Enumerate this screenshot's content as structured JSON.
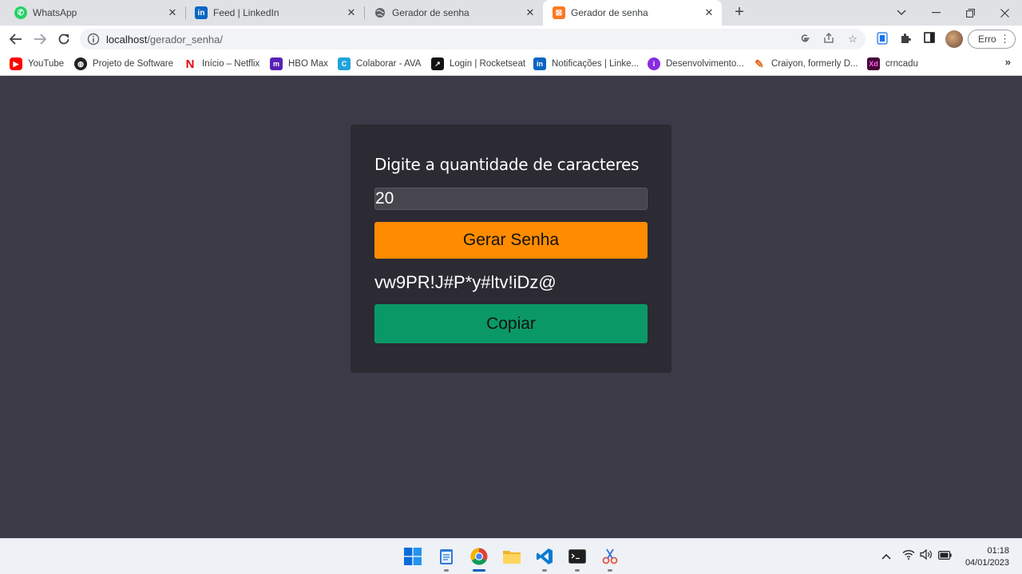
{
  "browser": {
    "tabs": [
      {
        "title": "WhatsApp",
        "icon": "whatsapp-icon",
        "color": "#25d366"
      },
      {
        "title": "Feed | LinkedIn",
        "icon": "linkedin-icon",
        "color": "#0a66c2"
      },
      {
        "title": "Gerador de senha",
        "icon": "globe-icon",
        "color": "#5f6368"
      },
      {
        "title": "Gerador de senha",
        "icon": "xampp-icon",
        "color": "#fb7a24",
        "active": true
      }
    ],
    "url_host": "localhost",
    "url_path": "/gerador_senha/",
    "profile_button": "Erro",
    "bookmarks": [
      {
        "label": "YouTube",
        "icon": "youtube-icon",
        "color": "#ff0000"
      },
      {
        "label": "Projeto de Software",
        "icon": "globe-icon",
        "color": "#202124"
      },
      {
        "label": "Início – Netflix",
        "icon": "netflix-icon",
        "color": "#e50914"
      },
      {
        "label": "HBO Max",
        "icon": "hbomax-icon",
        "color": "#5822b4"
      },
      {
        "label": "Colaborar - AVA",
        "icon": "colaborar-icon",
        "color": "#1fa3dc"
      },
      {
        "label": "Login | Rocketseat",
        "icon": "rocketseat-icon",
        "color": "#121214"
      },
      {
        "label": "Notificações | Linke...",
        "icon": "linkedin-icon",
        "color": "#0a66c2"
      },
      {
        "label": "Desenvolvimento...",
        "icon": "dev-icon",
        "color": "#8a2be2"
      },
      {
        "label": "Craiyon, formerly D...",
        "icon": "pencil-icon",
        "color": "#e46b1f"
      },
      {
        "label": "crncadu",
        "icon": "xd-icon",
        "color": "#470137"
      }
    ]
  },
  "app": {
    "heading": "Digite a quantidade de caracteres",
    "quantity_value": "20",
    "generate_label": "Gerar Senha",
    "password": "vw9PR!J#P*y#ltv!iDz@",
    "copy_label": "Copiar",
    "colors": {
      "background": "#3c3a47",
      "card": "#2c2a33",
      "generate": "#ff8c00",
      "copy": "#0a9966"
    }
  },
  "taskbar": {
    "time": "01:18",
    "date": "04/01/2023"
  }
}
